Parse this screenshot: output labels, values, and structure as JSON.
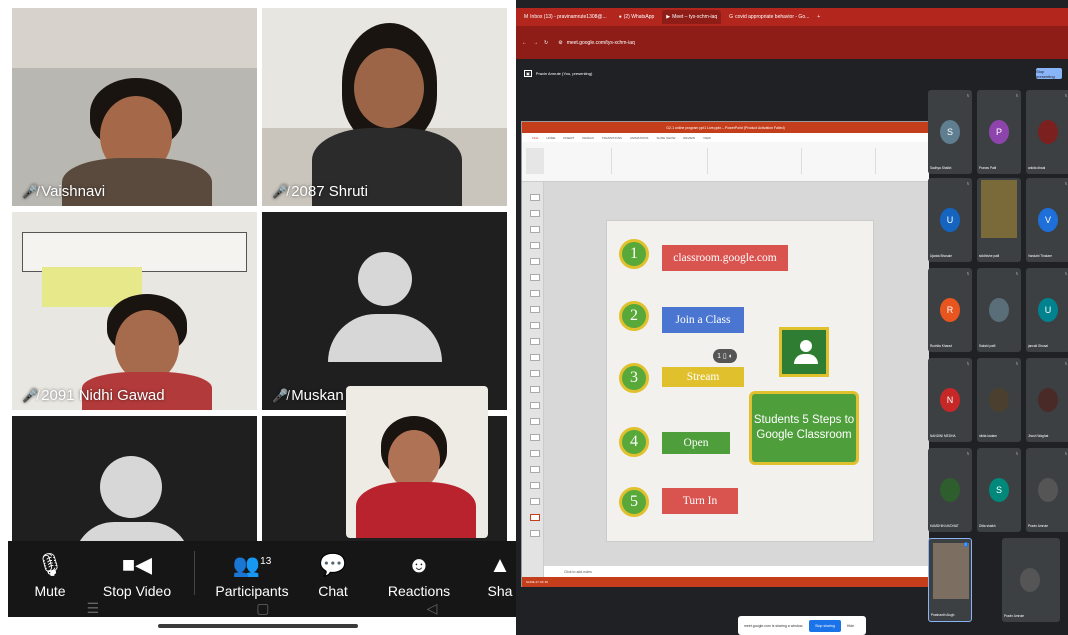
{
  "zoom": {
    "tiles": [
      {
        "name": "Vaishnavi"
      },
      {
        "name": "2087 Shruti"
      },
      {
        "name": "2091 Nidhi Gawad"
      },
      {
        "name": "Muskan"
      }
    ],
    "toolbar": {
      "mute": "Mute",
      "stop_video": "Stop Video",
      "participants": "Participants",
      "participants_count": "13",
      "chat": "Chat",
      "reactions": "Reactions",
      "share": "Sha"
    }
  },
  "browser": {
    "tabs": [
      "Inbox (13) - pravinamrute1308@...",
      "(2) WhatsApp",
      "Meet – tys-xchm-iaq",
      "covid appropriate behavior - Go..."
    ],
    "url": "meet.google.com/tys-xchm-iaq",
    "presenter": "Pravin Amrute (You, presenting)",
    "stop_presenting": "Stop presenting",
    "ppt_title": "G2-1 online program ppt1 Live.pptx – PowerPoint (Product Activation Failed)",
    "ppt_menu": [
      "FILE",
      "HOME",
      "INSERT",
      "DESIGN",
      "TRANSITIONS",
      "ANIMATIONS",
      "SLIDE SHOW",
      "REVIEW",
      "VIEW"
    ],
    "notes": "Click to add notes",
    "status": "SLIDE 27 OF 30",
    "slide": {
      "steps": [
        {
          "num": "1",
          "label": "classroom.google.com",
          "color": "#d9534f"
        },
        {
          "num": "2",
          "label": "Join a Class",
          "color": "#4a76d1"
        },
        {
          "num": "3",
          "label": "Stream",
          "color": "#e0c12d"
        },
        {
          "num": "4",
          "label": "Open",
          "color": "#4e9e3b"
        },
        {
          "num": "5",
          "label": "Turn In",
          "color": "#d9534f"
        }
      ],
      "summary": "Students 5 Steps to Google Classroom"
    },
    "participants": [
      {
        "name": "Sadhya Shaikh",
        "initial": "S",
        "color": "#5f7e8f"
      },
      {
        "name": "Pranav Patil",
        "initial": "P",
        "color": "#8e44ad"
      },
      {
        "name": "ankita dhaal",
        "initial": "",
        "color": "#7b1f1f"
      },
      {
        "name": "Ujwala Bhosale",
        "initial": "U",
        "color": "#1565c0"
      },
      {
        "name": "siddhishe patil",
        "initial": "",
        "color": "#7a6a3a"
      },
      {
        "name": "Vandahi Thakare",
        "initial": "V",
        "color": "#1e6fd9"
      },
      {
        "name": "Ruchita Kharad",
        "initial": "R",
        "color": "#e8551e"
      },
      {
        "name": "Sakshi patil",
        "initial": "",
        "color": "#5a6e7a"
      },
      {
        "name": "janvali Ghusal",
        "initial": "U",
        "color": "#00838f"
      },
      {
        "name": "NANDINI MEDHA",
        "initial": "N",
        "color": "#c62828"
      },
      {
        "name": "nikita kadam",
        "initial": "",
        "color": "#4b3f2e"
      },
      {
        "name": "Jhosh Waghat",
        "initial": "",
        "color": "#4a2a26"
      },
      {
        "name": "KAMDHINI AVDHAT",
        "initial": "",
        "color": "#2e5d2e"
      },
      {
        "name": "Ditta shaikh",
        "initial": "S",
        "color": "#00897b"
      },
      {
        "name": "Pravin Amrute",
        "initial": "",
        "color": "#333"
      },
      {
        "name": "Prashanth Alugh",
        "initial": "",
        "color": "#7c6e60"
      },
      {
        "name": "Pravin Amrute",
        "initial": "",
        "color": "#333"
      }
    ],
    "sharebar_text": "meet.google.com is sharing a window.",
    "sharebar_stop": "Stop sharing",
    "sharebar_hide": "Hide"
  }
}
